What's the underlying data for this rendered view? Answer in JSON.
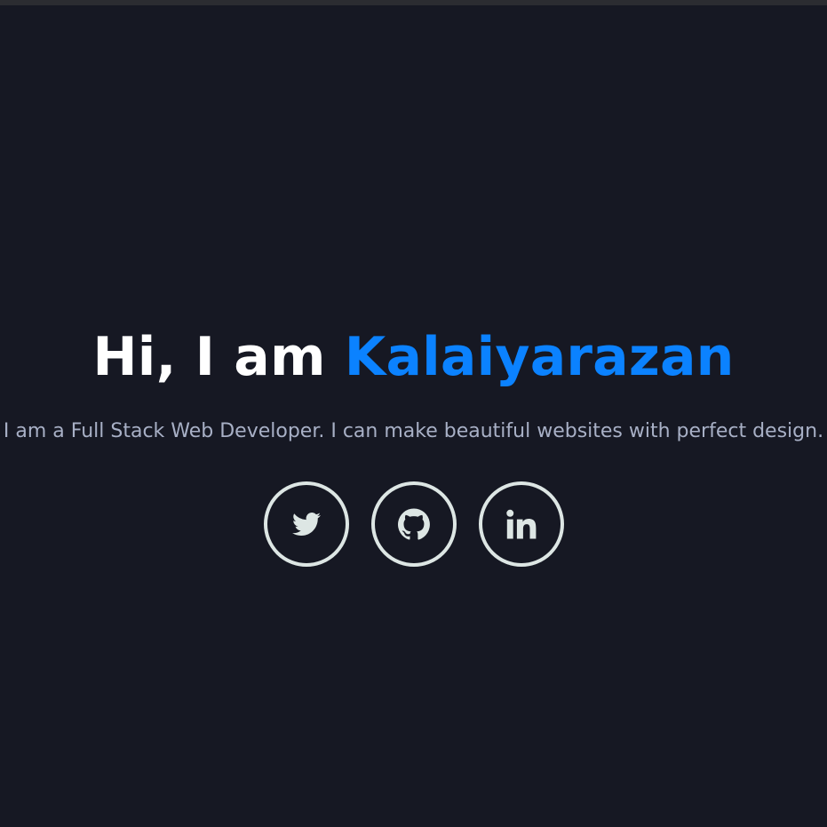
{
  "hero": {
    "greeting": "Hi, I am",
    "name": "Kalaiyarazan",
    "subtitle": "I am a Full Stack Web Developer. I can make beautiful websites with perfect design."
  },
  "socials": [
    {
      "name": "Twitter",
      "icon": "twitter-icon"
    },
    {
      "name": "GitHub",
      "icon": "github-icon"
    },
    {
      "name": "LinkedIn",
      "icon": "linkedin-icon"
    }
  ],
  "colors": {
    "background": "#161823",
    "accent": "#0b82ff",
    "title": "#ffffff",
    "subtitle": "#a8b0c6",
    "icon": "#dde6e4"
  }
}
